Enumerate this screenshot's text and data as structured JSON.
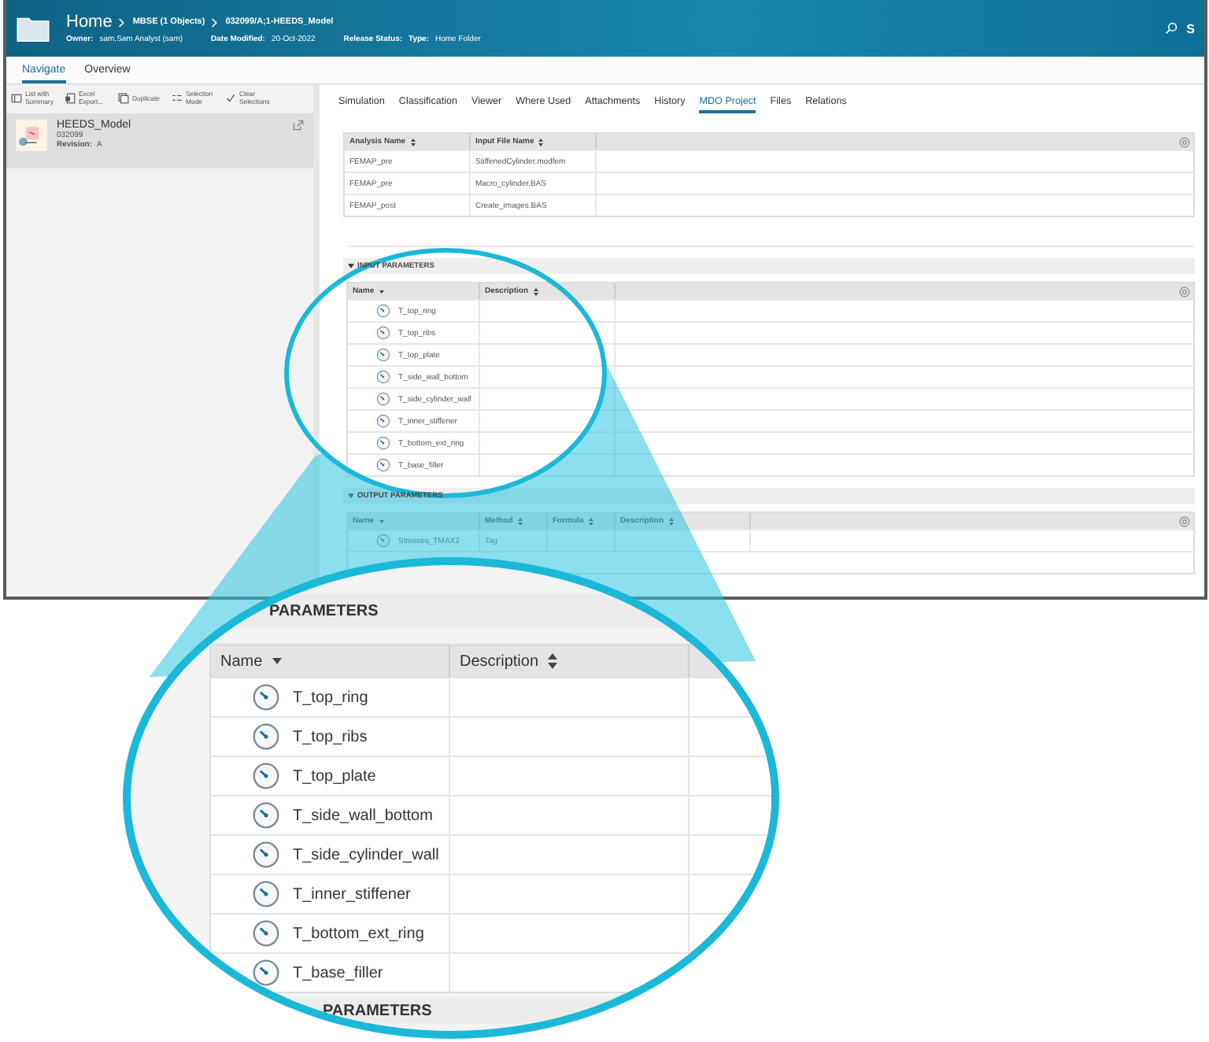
{
  "header": {
    "title": "Home",
    "breadcrumbs": [
      "MBSE (1 Objects)",
      "032099/A;1-HEEDS_Model"
    ],
    "user_initial": "S",
    "fields": [
      {
        "label": "Owner:",
        "value": "sam,Sam Analyst (sam)"
      },
      {
        "label": "Date Modified:",
        "value": "20-Oct-2022"
      },
      {
        "label": "Release Status:"
      },
      {
        "label": "Type:",
        "value": "Home Folder"
      }
    ]
  },
  "view_tabs": [
    {
      "label": "Navigate",
      "selected": true
    },
    {
      "label": "Overview",
      "selected": false
    }
  ],
  "toolbar": [
    {
      "label": "List with Summary",
      "kind": "list"
    },
    {
      "label": "Excel Export...",
      "kind": "excel"
    },
    {
      "label": "Duplicate",
      "kind": "duplicate"
    },
    {
      "label": "Selection Mode",
      "kind": "selection"
    },
    {
      "label": "Clear Selections",
      "kind": "clear"
    }
  ],
  "object": {
    "name": "HEEDS_Model",
    "id": "032099",
    "revision_label": "Revision:",
    "revision": "A",
    "selected": true
  },
  "detail_tabs": [
    {
      "label": "Simulation",
      "selected": false
    },
    {
      "label": "Classification",
      "selected": false
    },
    {
      "label": "Viewer",
      "selected": false
    },
    {
      "label": "Where Used",
      "selected": false
    },
    {
      "label": "Attachments",
      "selected": false
    },
    {
      "label": "History",
      "selected": false
    },
    {
      "label": "MDO Project",
      "selected": true
    },
    {
      "label": "Files",
      "selected": false
    },
    {
      "label": "Relations",
      "selected": false
    }
  ],
  "analysis_table": {
    "columns": [
      "Analysis Name",
      "Input File Name"
    ],
    "rows": [
      [
        "FEMAP_pre",
        "StiffenedCylinder.modfem"
      ],
      [
        "FEMAP_pre",
        "Macro_cylinder.BAS"
      ],
      [
        "FEMAP_post",
        "Create_images.BAS"
      ]
    ]
  },
  "input_parameters": {
    "title": "INPUT PARAMETERS",
    "columns": [
      "Name",
      "Description"
    ],
    "rows": [
      "T_top_ring",
      "T_top_ribs",
      "T_top_plate",
      "T_side_wall_bottom",
      "T_side_cylinder_wall",
      "T_inner_stiffener",
      "T_bottom_ext_ring",
      "T_base_filler"
    ]
  },
  "output_parameters": {
    "title": "OUTPUT PARAMETERS",
    "columns": [
      "Name",
      "Method",
      "Formula",
      "Description"
    ],
    "rows": [
      {
        "name": "Stresses_TMAX2",
        "method": "Tag"
      }
    ]
  },
  "magnifier": {
    "title_top": "PARAMETERS",
    "columns": [
      "Name",
      "Description"
    ],
    "rows": [
      "T_top_ring",
      "T_top_ribs",
      "T_top_plate",
      "T_side_wall_bottom",
      "T_side_cylinder_wall",
      "T_inner_stiffener",
      "T_bottom_ext_ring",
      "T_base_filler"
    ],
    "title_bottom": "PARAMETERS"
  }
}
